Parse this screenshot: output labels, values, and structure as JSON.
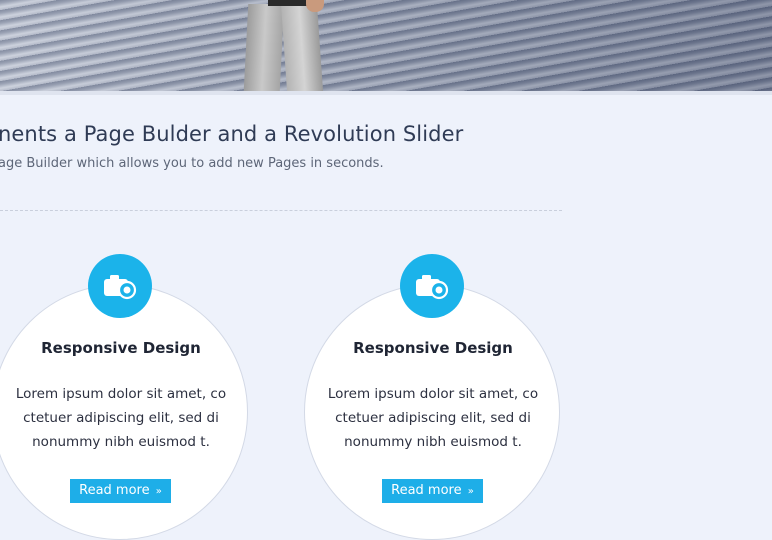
{
  "hero": {
    "image": "businessman-standing-on-deck-photo"
  },
  "intro": {
    "headline": "nents a Page Bulder and a Revolution Slider",
    "subline": "age Builder which allows you to add new Pages in seconds."
  },
  "features": [
    {
      "icon": "camera-icon",
      "title": "Responsive Design",
      "text": "Lorem ipsum dolor sit amet, co ctetuer adipiscing elit, sed di nonummy nibh euismod t.",
      "button_label": "Read more",
      "button_chevron": "»"
    },
    {
      "icon": "camera-icon",
      "title": "Responsive Design",
      "text": "Lorem ipsum dolor sit amet, co ctetuer adipiscing elit, sed di nonummy nibh euismod t.",
      "button_label": "Read more",
      "button_chevron": "»"
    }
  ],
  "colors": {
    "accent": "#1eaee8",
    "background": "#eef2fb",
    "heading": "#2f3b55"
  }
}
